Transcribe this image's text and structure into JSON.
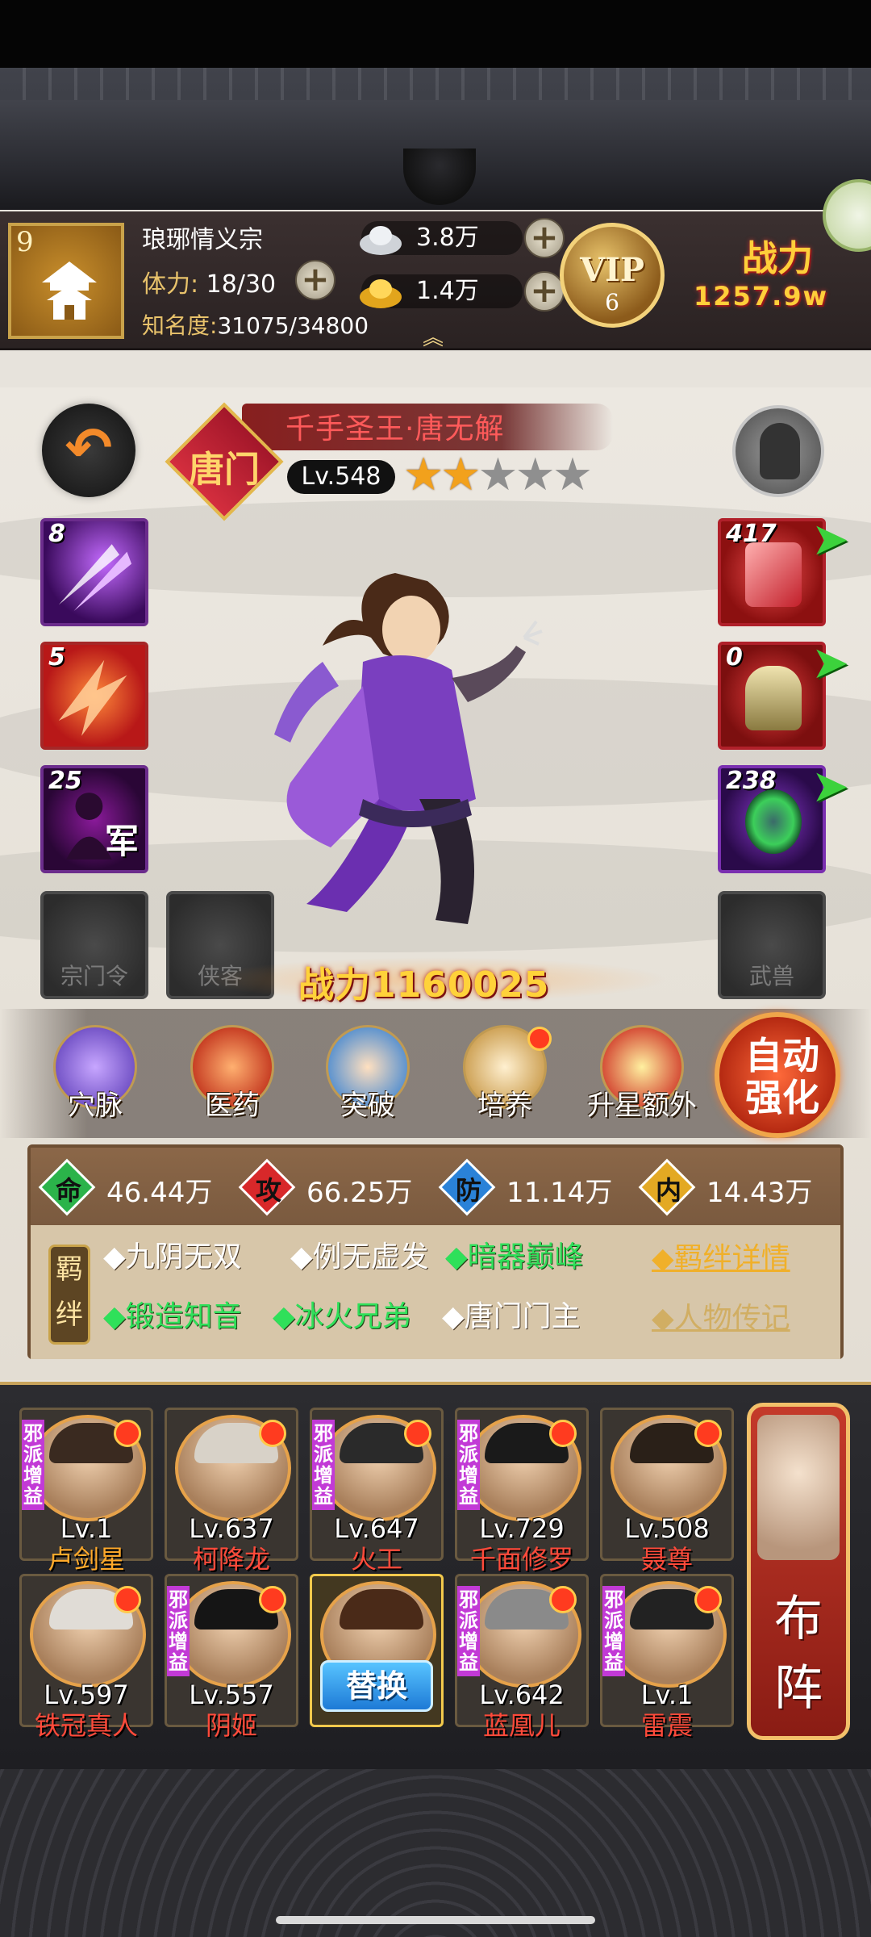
{
  "header": {
    "sect_level": "9",
    "sect_name": "琅琊情义宗",
    "stamina_label": "体力:",
    "stamina_value": "18/30",
    "fame_label": "知名度:",
    "fame_value": "31075/34800",
    "silver": "3.8万",
    "gold": "1.4万",
    "vip_label": "VIP",
    "vip_level": "6",
    "power_title": "战力",
    "power_value": "1257.9w"
  },
  "hero": {
    "name": "千手圣王·唐无解",
    "sect_badge": "唐门",
    "level": "Lv.548",
    "stars_filled": 2,
    "stars_total": 5,
    "power_label": "战力",
    "power_value": "1160025"
  },
  "skills": [
    {
      "count": "8",
      "icon": "dart-burst-icon"
    },
    {
      "count": "5",
      "icon": "flame-slash-icon"
    },
    {
      "count": "25",
      "icon": "army-spirit-icon",
      "badge": "军"
    }
  ],
  "equipment": [
    {
      "count": "417",
      "icon": "crossbow-icon"
    },
    {
      "count": "0",
      "icon": "armor-icon"
    },
    {
      "count": "238",
      "icon": "jade-orb-icon"
    }
  ],
  "empty_slots": {
    "sect_order": "宗门令",
    "knight": "侠客",
    "beast": "武兽"
  },
  "functions": [
    {
      "label": "穴脉",
      "icon": "meridian-icon",
      "dot": false
    },
    {
      "label": "医药",
      "icon": "herb-icon",
      "dot": false
    },
    {
      "label": "突破",
      "icon": "breakthrough-icon",
      "dot": false
    },
    {
      "label": "培养",
      "icon": "scroll-icon",
      "dot": true
    },
    {
      "label": "升星额外",
      "icon": "star-up-icon",
      "dot": false
    }
  ],
  "auto_strengthen": "自动强化",
  "stats": [
    {
      "key": "命",
      "value": "46.44万",
      "color": "#2bb34a"
    },
    {
      "key": "攻",
      "value": "66.25万",
      "color": "#d8282a"
    },
    {
      "key": "防",
      "value": "11.14万",
      "color": "#2a82d8"
    },
    {
      "key": "内",
      "value": "14.43万",
      "color": "#e3a923"
    }
  ],
  "fetters": {
    "badge": "羁绊",
    "row1": [
      {
        "text": "◆九阴无双",
        "active": false
      },
      {
        "text": "◆例无虚发",
        "active": false
      },
      {
        "text": "◆暗器巅峰",
        "active": true
      }
    ],
    "row2": [
      {
        "text": "◆锻造知音",
        "active": true
      },
      {
        "text": "◆冰火兄弟",
        "active": true
      },
      {
        "text": "◆唐门门主",
        "active": false
      }
    ],
    "detail_link": "◆羁绊详情",
    "bio_link": "◆人物传记"
  },
  "lineup": {
    "tag": "邪派增益",
    "swap": "替换",
    "formation": "布阵",
    "row1": [
      {
        "level": "Lv.1",
        "name": "卢剑星",
        "name_color": "orange",
        "tag": true
      },
      {
        "level": "Lv.637",
        "name": "柯降龙",
        "name_color": "red",
        "tag": false
      },
      {
        "level": "Lv.647",
        "name": "火工",
        "name_color": "red",
        "tag": true
      },
      {
        "level": "Lv.729",
        "name": "千面修罗",
        "name_color": "red",
        "tag": true
      },
      {
        "level": "Lv.508",
        "name": "聂尊",
        "name_color": "red",
        "tag": false
      }
    ],
    "row2": [
      {
        "level": "Lv.597",
        "name": "铁冠真人",
        "name_color": "red",
        "tag": false
      },
      {
        "level": "Lv.557",
        "name": "阴姬",
        "name_color": "red",
        "tag": true
      },
      {
        "level": "",
        "name": "",
        "name_color": "red",
        "tag": false,
        "selected": true
      },
      {
        "level": "Lv.642",
        "name": "蓝凰儿",
        "name_color": "red",
        "tag": true
      },
      {
        "level": "Lv.1",
        "name": "雷震",
        "name_color": "red",
        "tag": true
      }
    ]
  }
}
